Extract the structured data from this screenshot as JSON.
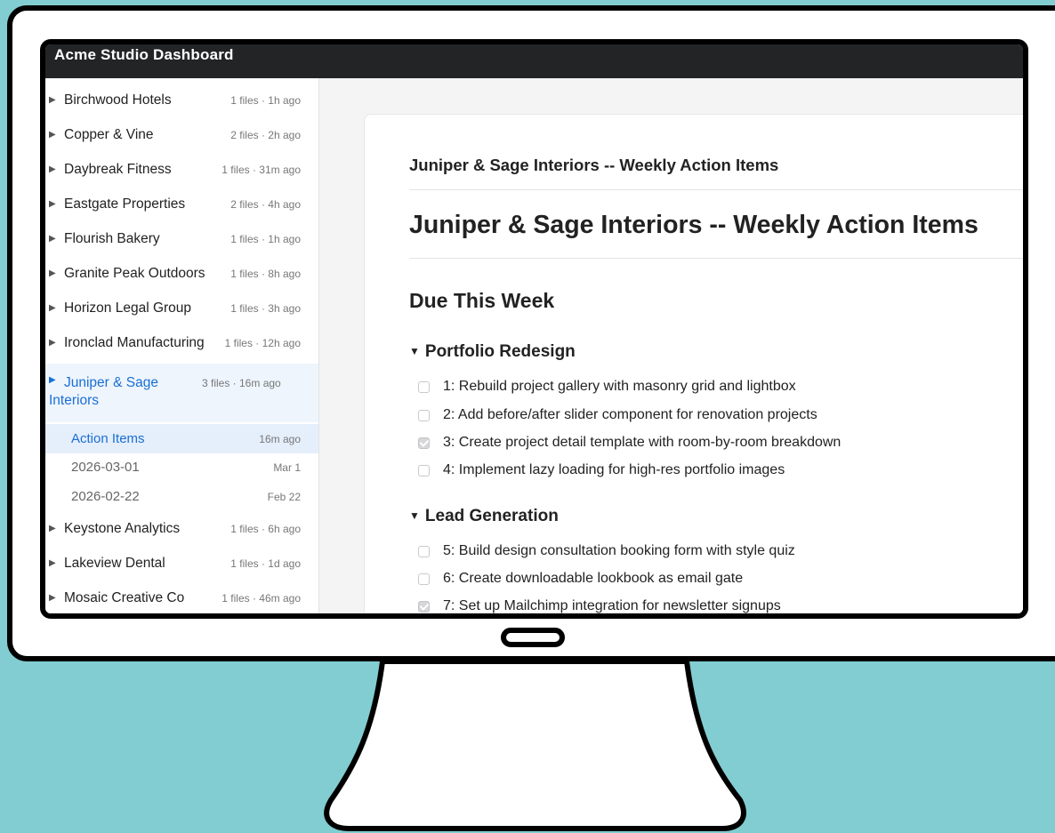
{
  "app": {
    "title": "Acme Studio Dashboard"
  },
  "sidebar": {
    "clients": [
      {
        "name": "Birchwood Hotels",
        "meta": "1 files · 1h ago"
      },
      {
        "name": "Copper & Vine",
        "meta": "2 files · 2h ago"
      },
      {
        "name": "Daybreak Fitness",
        "meta": "1 files · 31m ago"
      },
      {
        "name": "Eastgate Properties",
        "meta": "2 files · 4h ago"
      },
      {
        "name": "Flourish Bakery",
        "meta": "1 files · 1h ago"
      },
      {
        "name": "Granite Peak Outdoors",
        "meta": "1 files · 8h ago"
      },
      {
        "name": "Horizon Legal Group",
        "meta": "1 files · 3h ago"
      },
      {
        "name": "Ironclad Manufacturing",
        "meta": "1 files · 12h ago"
      },
      {
        "name_line1": "Juniper & Sage",
        "name_line2": "Interiors",
        "meta": "3 files · 16m ago",
        "files": [
          {
            "name": "Action Items",
            "date": "16m ago"
          },
          {
            "name": "2026-03-01",
            "date": "Mar 1"
          },
          {
            "name": "2026-02-22",
            "date": "Feb 22"
          }
        ]
      },
      {
        "name": "Keystone Analytics",
        "meta": "1 files · 6h ago"
      },
      {
        "name": "Lakeview Dental",
        "meta": "1 files · 1d ago"
      },
      {
        "name": "Mosaic Creative Co",
        "meta": "1 files · 46m ago"
      }
    ]
  },
  "document": {
    "header": "Juniper & Sage Interiors -- Weekly Action Items",
    "title": "Juniper & Sage Interiors -- Weekly Action Items",
    "section": "Due This Week",
    "groups": [
      {
        "title": "Portfolio Redesign",
        "tasks": [
          {
            "text": "1: Rebuild project gallery with masonry grid and lightbox",
            "checked": false
          },
          {
            "text": "2: Add before/after slider component for renovation projects",
            "checked": false
          },
          {
            "text": "3: Create project detail template with room-by-room breakdown",
            "checked": true
          },
          {
            "text": "4: Implement lazy loading for high-res portfolio images",
            "checked": false
          }
        ]
      },
      {
        "title": "Lead Generation",
        "tasks": [
          {
            "text": "5: Build design consultation booking form with style quiz",
            "checked": false
          },
          {
            "text": "6: Create downloadable lookbook as email gate",
            "checked": false
          },
          {
            "text": "7: Set up Mailchimp integration for newsletter signups",
            "checked": true
          }
        ]
      }
    ]
  },
  "colors": {
    "accent": "#1a6fd4",
    "titlebar": "#222426",
    "backdrop": "#82cdd1"
  }
}
